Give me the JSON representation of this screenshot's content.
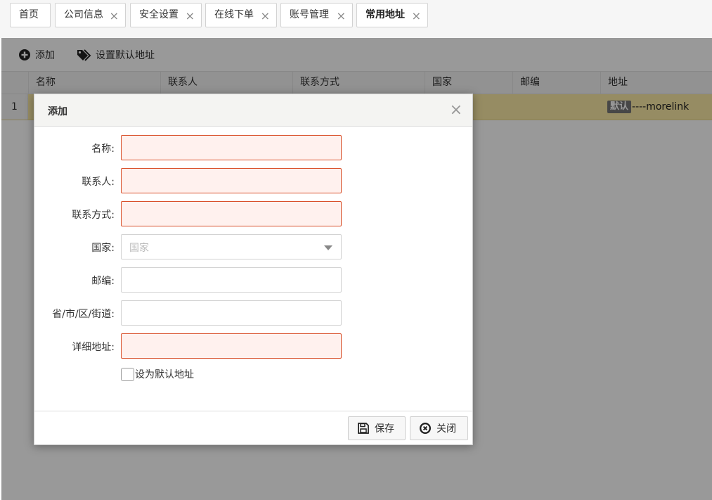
{
  "tabs": [
    {
      "label": "首页",
      "closable": false
    },
    {
      "label": "公司信息",
      "closable": true
    },
    {
      "label": "安全设置",
      "closable": true
    },
    {
      "label": "在线下单",
      "closable": true
    },
    {
      "label": "账号管理",
      "closable": true
    },
    {
      "label": "常用地址",
      "closable": true,
      "active": true
    }
  ],
  "tab_close_glyph": "×",
  "toolbar": {
    "add_label": "添加",
    "set_default_label": "设置默认地址"
  },
  "grid": {
    "columns": [
      "名称",
      "联系人",
      "联系方式",
      "国家",
      "邮编",
      "地址"
    ],
    "rows": [
      {
        "row_number": "1",
        "address_badge": "默认",
        "address_text": "----morelink"
      }
    ]
  },
  "dialog": {
    "title": "添加",
    "close_glyph": "×",
    "fields": {
      "name": {
        "label": "名称:",
        "value": ""
      },
      "contact": {
        "label": "联系人:",
        "value": ""
      },
      "contact_method": {
        "label": "联系方式:",
        "value": ""
      },
      "country": {
        "label": "国家:",
        "placeholder": "国家"
      },
      "postcode": {
        "label": "邮编:",
        "value": ""
      },
      "region": {
        "label": "省/市/区/街道:",
        "value": ""
      },
      "detail_address": {
        "label": "详细地址:",
        "value": ""
      }
    },
    "default_checkbox_label": "设为默认地址",
    "save_label": "保存",
    "close_label": "关闭"
  },
  "colors": {
    "invalid_border": "#d9502a",
    "invalid_bg": "#fff1ee",
    "selected_row": "#fbe9a6",
    "overlay": "rgba(0,0,0,0.40)"
  }
}
